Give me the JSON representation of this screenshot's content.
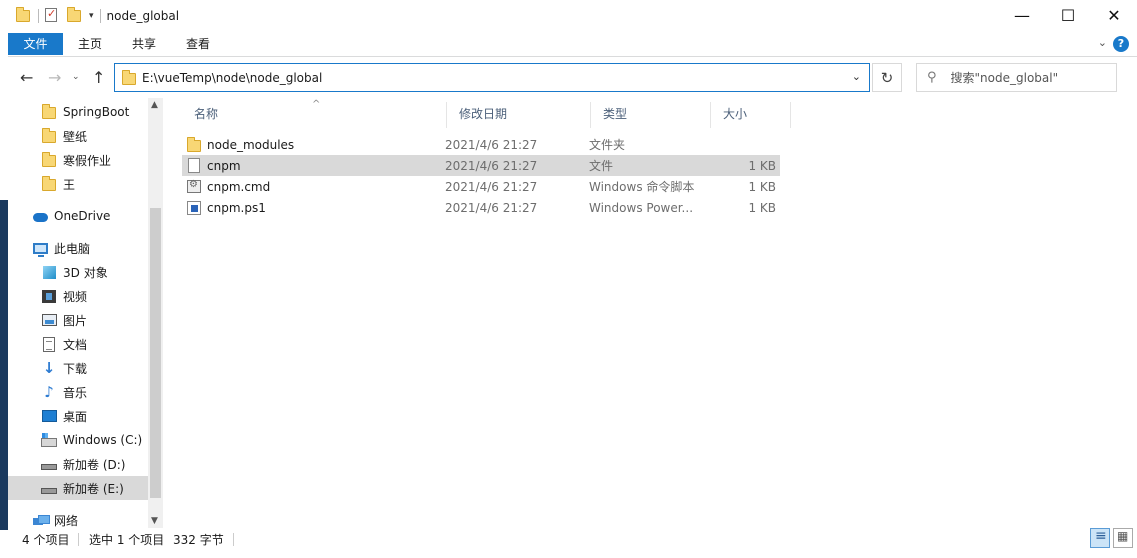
{
  "window": {
    "title": "node_global",
    "controls": {
      "minimize": "—",
      "maximize": "☐",
      "close": "✕"
    }
  },
  "ribbon": {
    "tabs": [
      "文件",
      "主页",
      "共享",
      "查看"
    ],
    "help": "?"
  },
  "address": {
    "path": "E:\\vueTemp\\node\\node_global",
    "search_placeholder": "搜索\"node_global\""
  },
  "nav_pane": {
    "items": [
      {
        "label": "SpringBoot",
        "icon": "folder-icon",
        "indent": 1
      },
      {
        "label": "壁纸",
        "icon": "folder-icon",
        "indent": 1
      },
      {
        "label": "寒假作业",
        "icon": "folder-icon",
        "indent": 1
      },
      {
        "label": "王",
        "icon": "folder-icon",
        "indent": 1
      },
      {
        "label": "OneDrive",
        "icon": "onedrive-icon",
        "indent": 0
      },
      {
        "label": "此电脑",
        "icon": "this-pc-icon",
        "indent": 0
      },
      {
        "label": "3D 对象",
        "icon": "3d-objects-icon",
        "indent": 1
      },
      {
        "label": "视频",
        "icon": "videos-icon",
        "indent": 1
      },
      {
        "label": "图片",
        "icon": "pictures-icon",
        "indent": 1
      },
      {
        "label": "文档",
        "icon": "documents-icon",
        "indent": 1
      },
      {
        "label": "下载",
        "icon": "downloads-icon",
        "indent": 1
      },
      {
        "label": "音乐",
        "icon": "music-icon",
        "indent": 1
      },
      {
        "label": "桌面",
        "icon": "desktop-icon",
        "indent": 1
      },
      {
        "label": "Windows (C:)",
        "icon": "drive-c-icon",
        "indent": 1
      },
      {
        "label": "新加卷 (D:)",
        "icon": "drive-icon",
        "indent": 1
      },
      {
        "label": "新加卷 (E:)",
        "icon": "drive-icon",
        "indent": 1,
        "selected": true
      },
      {
        "label": "网络",
        "icon": "network-icon",
        "indent": 0
      }
    ]
  },
  "columns": {
    "name": "名称",
    "date": "修改日期",
    "type": "类型",
    "size": "大小"
  },
  "files": [
    {
      "name": "node_modules",
      "date": "2021/4/6 21:27",
      "type": "文件夹",
      "size": "",
      "icon": "folder-icon"
    },
    {
      "name": "cnpm",
      "date": "2021/4/6 21:27",
      "type": "文件",
      "size": "1 KB",
      "icon": "file-icon",
      "selected": true
    },
    {
      "name": "cnpm.cmd",
      "date": "2021/4/6 21:27",
      "type": "Windows 命令脚本",
      "size": "1 KB",
      "icon": "cmd-script-icon"
    },
    {
      "name": "cnpm.ps1",
      "date": "2021/4/6 21:27",
      "type": "Windows Power...",
      "size": "1 KB",
      "icon": "powershell-script-icon"
    }
  ],
  "status": {
    "item_count": "4 个项目",
    "selection": "选中 1 个项目",
    "size": "332 字节"
  },
  "colors": {
    "accent": "#1979ca",
    "selection": "#d9d9d9",
    "header_text": "#4c607a"
  }
}
